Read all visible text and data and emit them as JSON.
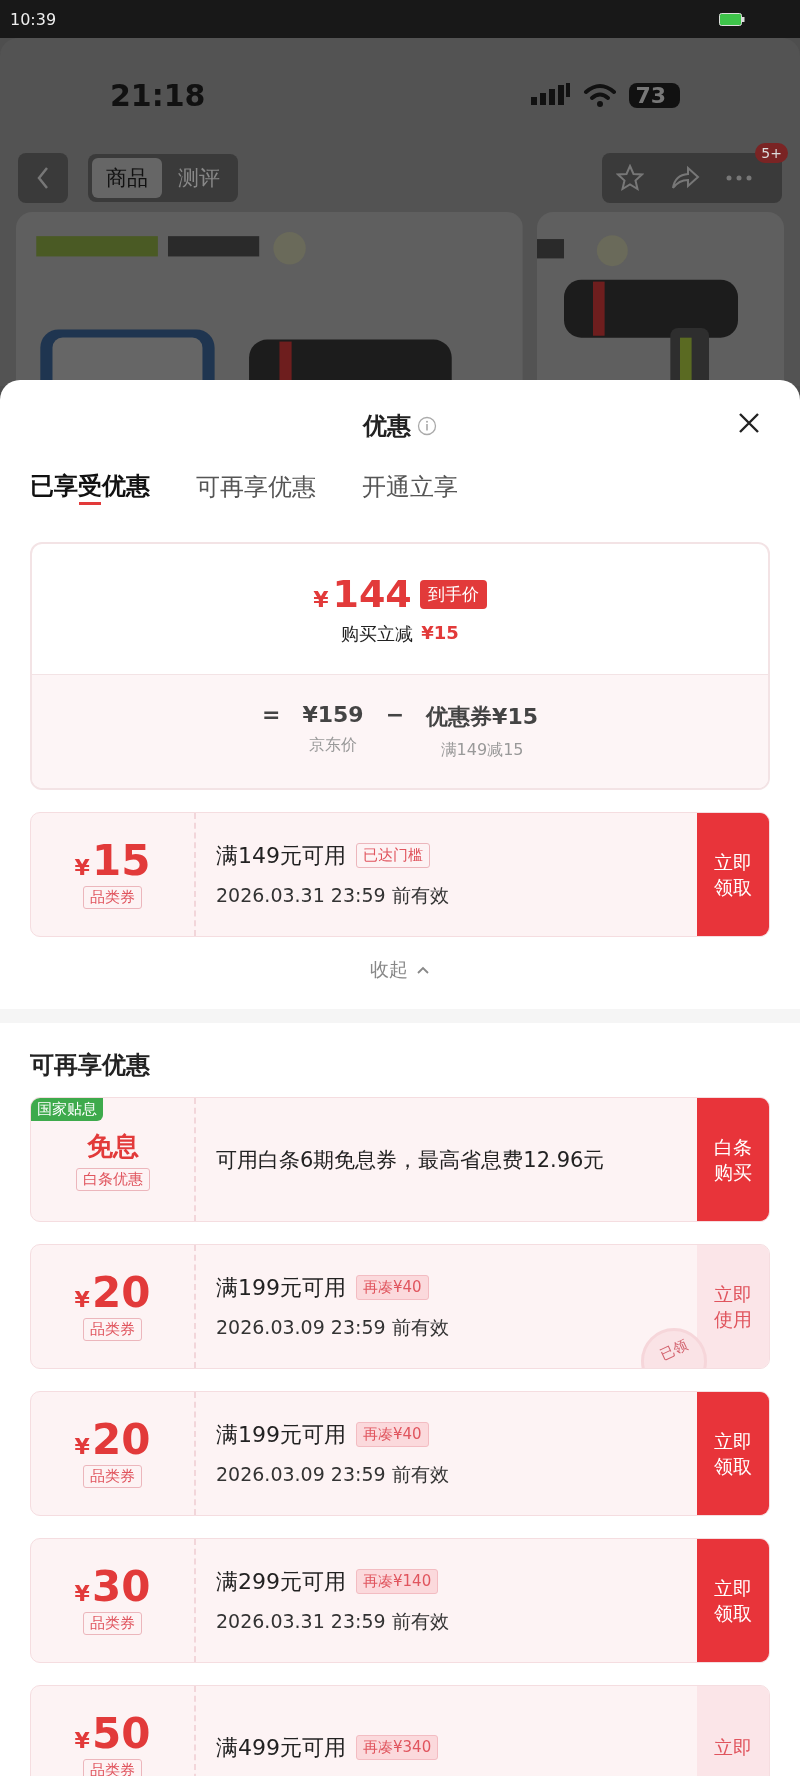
{
  "device_status": {
    "time": "10:39"
  },
  "background_page": {
    "status_bar": {
      "time": "21:18",
      "battery": "73"
    },
    "tabs": [
      {
        "label": "商品",
        "selected": true
      },
      {
        "label": "测评",
        "selected": false
      }
    ],
    "more_badge": "5+"
  },
  "sheet": {
    "title": "优惠",
    "tabs": [
      {
        "label": "已享受优惠",
        "selected": true
      },
      {
        "label": "可再享优惠",
        "selected": false
      },
      {
        "label": "开通立享",
        "selected": false
      }
    ],
    "summary": {
      "currency": "¥",
      "price": "144",
      "price_tag": "到手价",
      "saving_label": "购买立减",
      "saving": "¥15",
      "equals": "=",
      "minus": "−",
      "terms": [
        {
          "value": "¥159",
          "label": "京东价"
        },
        {
          "value": "优惠券¥15",
          "label": "满149减15"
        }
      ]
    },
    "enjoyed": [
      {
        "kind": "coupon",
        "currency": "¥",
        "amount": "15",
        "type_tag": "品类券",
        "condition": "满149元可用",
        "badge": {
          "kind": "reached",
          "text": "已达门槛"
        },
        "expiry": "2026.03.31 23:59 前有效",
        "action": "立即领取",
        "claimed": false
      }
    ],
    "collapse": "收起",
    "more_title": "可再享优惠",
    "more": [
      {
        "kind": "interest",
        "corner_tag": "国家贴息",
        "title": "免息",
        "type_tag": "白条优惠",
        "description": "可用白条6期免息券，最高省息费12.96元",
        "action": "白条购买",
        "claimed": false
      },
      {
        "kind": "coupon",
        "currency": "¥",
        "amount": "20",
        "type_tag": "品类券",
        "condition": "满199元可用",
        "badge": {
          "kind": "short",
          "text": "再凑¥40"
        },
        "expiry": "2026.03.09 23:59 前有效",
        "action": "立即使用",
        "claimed": true,
        "stamp": "已领"
      },
      {
        "kind": "coupon",
        "currency": "¥",
        "amount": "20",
        "type_tag": "品类券",
        "condition": "满199元可用",
        "badge": {
          "kind": "short",
          "text": "再凑¥40"
        },
        "expiry": "2026.03.09 23:59 前有效",
        "action": "立即领取",
        "claimed": false
      },
      {
        "kind": "coupon",
        "currency": "¥",
        "amount": "30",
        "type_tag": "品类券",
        "condition": "满299元可用",
        "badge": {
          "kind": "short",
          "text": "再凑¥140"
        },
        "expiry": "2026.03.31 23:59 前有效",
        "action": "立即领取",
        "claimed": false
      },
      {
        "kind": "coupon",
        "currency": "¥",
        "amount": "50",
        "type_tag": "品类券",
        "condition": "满499元可用",
        "badge": {
          "kind": "short",
          "text": "再凑¥340"
        },
        "action": "立即",
        "claimed": true
      }
    ]
  }
}
